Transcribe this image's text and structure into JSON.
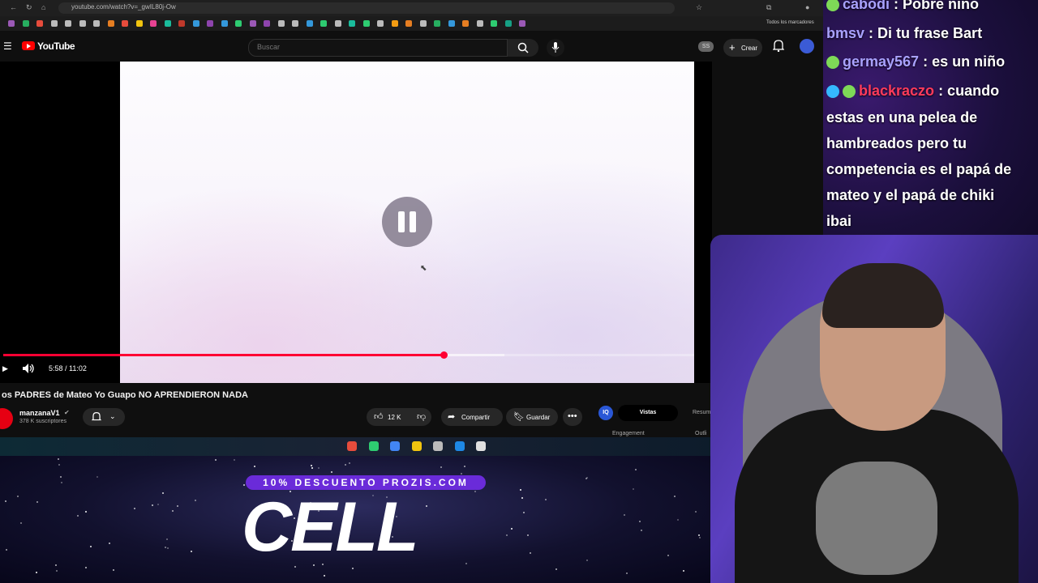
{
  "browser": {
    "url": "youtube.com/watch?v=_gwIL80j-Ow",
    "bookmarks_all_label": "Todos los marcadores",
    "bookmark_colors": [
      "#9b59b6",
      "#27ae60",
      "#e74c3c",
      "#bbbbbb",
      "#bbbbbb",
      "#bbbbbb",
      "#bbbbbb",
      "#e67e22",
      "#e74c3c",
      "#f1c40f",
      "#e84393",
      "#1abc9c",
      "#c0392b",
      "#3498db",
      "#8e44ad",
      "#3498db",
      "#2ecc71",
      "#9b59b6",
      "#8e44ad",
      "#bbbbbb",
      "#bbbbbb",
      "#3498db",
      "#2ecc71",
      "#bbbbbb",
      "#1abc9c",
      "#2ecc71",
      "#bbbbbb",
      "#f39c12",
      "#e67e22",
      "#bbbbbb",
      "#27ae60",
      "#3498db",
      "#e67e22",
      "#bbbbbb",
      "#2ecc71",
      "#16a085",
      "#9b59b6"
    ]
  },
  "youtube": {
    "brand": "YouTube",
    "search_placeholder": "Buscar",
    "ss_badge": "SS",
    "create_label": "Crear"
  },
  "player": {
    "time": "5:58 / 11:02",
    "played_fraction": 0.637,
    "buffered_fraction": 0.725
  },
  "video": {
    "title": "os PADRES de Mateo Yo Guapo NO APRENDIERON NADA",
    "channel": "manzanaV1",
    "verified": "✔",
    "subscribers": "378 K suscriptores",
    "likes": "12 K",
    "share_label": "Compartir",
    "save_label": "Guardar"
  },
  "extension": {
    "iq_label": "IQ",
    "tab_active": "Vistas",
    "tab_other": "Resum",
    "engagement_label": "Engagement",
    "outline_label": "Outli"
  },
  "chat": {
    "messages": [
      {
        "user": "cabodi",
        "text": ": Pobre niño",
        "badges": [
          "#7ed957"
        ]
      },
      {
        "user": "bmsv",
        "text": ": Di tu frase Bart",
        "badges": []
      },
      {
        "user": "germay567",
        "text": ": es un niño",
        "badges": [
          "#7ed957"
        ]
      },
      {
        "user": "blackraczo",
        "text": ": cuando",
        "badges": [
          "#35b8ff",
          "#7ed957"
        ],
        "user_color": "#ff3b5c"
      }
    ],
    "continuation": [
      "estas en una pelea de",
      "hambreados pero tu",
      "competencia es el papá de",
      "mateo y el papá de chiki",
      "ibai"
    ]
  },
  "sponsor": {
    "promo_text": "10% DESCUENTO PROZIS.COM",
    "logo_text": "CELL"
  },
  "taskbar_colors": [
    "#e74c3c",
    "#2ecc71",
    "#4285f4",
    "#f1c40f",
    "#bbbbbb",
    "#1e88e5",
    "#e0e0e0"
  ]
}
